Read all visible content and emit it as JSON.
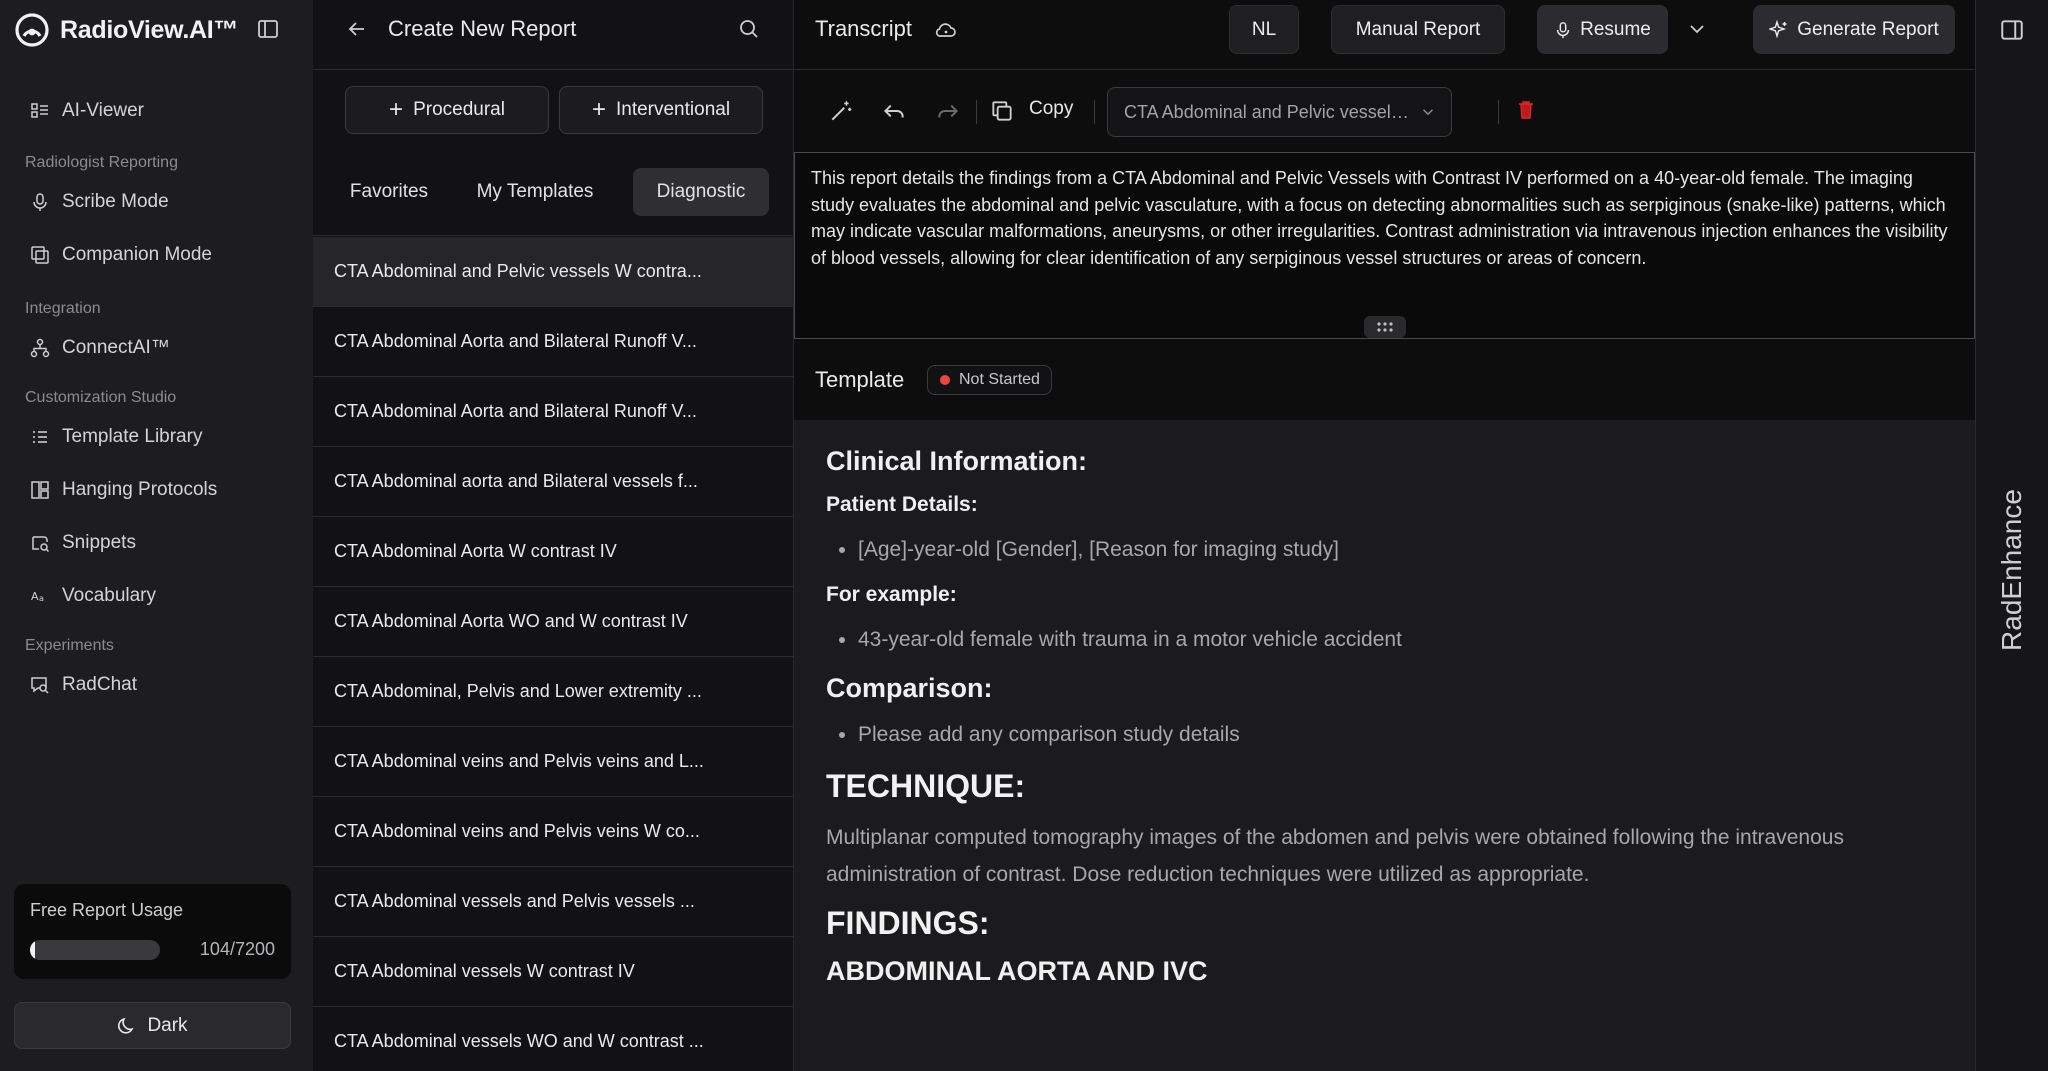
{
  "brand": {
    "name": "RadioView.AI™"
  },
  "sidebar": {
    "items_top": [
      {
        "label": "AI-Viewer",
        "icon": "grid-list-icon"
      }
    ],
    "sections": [
      {
        "title": "Radiologist Reporting",
        "items": [
          {
            "label": "Scribe Mode",
            "icon": "mic-icon"
          },
          {
            "label": "Companion Mode",
            "icon": "copy-window-icon"
          }
        ]
      },
      {
        "title": "Integration",
        "items": [
          {
            "label": "ConnectAI™",
            "icon": "network-icon"
          }
        ]
      },
      {
        "title": "Customization Studio",
        "items": [
          {
            "label": "Template Library",
            "icon": "list-icon"
          },
          {
            "label": "Hanging Protocols",
            "icon": "layout-icon"
          },
          {
            "label": "Snippets",
            "icon": "snippet-icon"
          },
          {
            "label": "Vocabulary",
            "icon": "vocabulary-icon"
          }
        ]
      },
      {
        "title": "Experiments",
        "items": [
          {
            "label": "RadChat",
            "icon": "chat-icon"
          }
        ]
      }
    ],
    "usage": {
      "title": "Free Report Usage",
      "used": 104,
      "total": 7200,
      "count_text": "104/7200"
    },
    "theme_button": "Dark"
  },
  "middle": {
    "title": "Create New Report",
    "buttons": {
      "procedural": "Procedural",
      "interventional": "Interventional"
    },
    "tabs": [
      "Favorites",
      "My Templates",
      "Diagnostic"
    ],
    "active_tab": "Diagnostic",
    "templates": [
      "CTA Abdominal and Pelvic vessels W contra...",
      "CTA Abdominal Aorta and Bilateral Runoff V...",
      "CTA Abdominal Aorta and Bilateral Runoff V...",
      "CTA Abdominal aorta and Bilateral vessels f...",
      "CTA Abdominal Aorta W contrast IV",
      "CTA Abdominal Aorta WO and W contrast IV",
      "CTA Abdominal, Pelvis and Lower extremity ...",
      "CTA Abdominal veins and Pelvis veins and L...",
      "CTA Abdominal veins and Pelvis veins W co...",
      "CTA Abdominal vessels and Pelvis vessels ...",
      "CTA Abdominal vessels W contrast IV",
      "CTA Abdominal vessels WO and W contrast ..."
    ]
  },
  "right": {
    "header": {
      "title": "Transcript",
      "nl": "NL",
      "manual_report": "Manual Report",
      "resume": "Resume",
      "generate_report": "Generate Report"
    },
    "toolbar": {
      "copy": "Copy",
      "template_select": "CTA Abdominal and Pelvic vessels ..."
    },
    "transcript_text": "This report details the findings from a CTA Abdominal and Pelvic Vessels with Contrast IV performed on a 40-year-old female. The imaging study evaluates the abdominal and pelvic vasculature, with a focus on detecting abnormalities such as serpiginous (snake-like) patterns, which may indicate vascular malformations, aneurysms, or other irregularities. Contrast administration via intravenous injection enhances the visibility of blood vessels, allowing for clear identification of any serpiginous vessel structures or areas of concern.",
    "template": {
      "title": "Template",
      "status": "Not Started",
      "status_color": "#ef4444",
      "clinical_heading": "Clinical Information:",
      "patient_details_heading": "Patient Details:",
      "patient_details_item": "[Age]-year-old [Gender], [Reason for imaging study]",
      "example_heading": "For example:",
      "example_item": "43-year-old female with trauma in a motor vehicle accident",
      "comparison_heading": "Comparison:",
      "comparison_item": "Please add any comparison study details",
      "technique_heading": "TECHNIQUE:",
      "technique_text": "Multiplanar computed tomography images of the abdomen and pelvis were obtained following the intravenous administration of contrast. Dose reduction techniques were utilized as appropriate.",
      "findings_heading": "FINDINGS:",
      "aorta_heading": "ABDOMINAL AORTA AND IVC"
    }
  },
  "strip": {
    "label": "RadEnhance"
  }
}
